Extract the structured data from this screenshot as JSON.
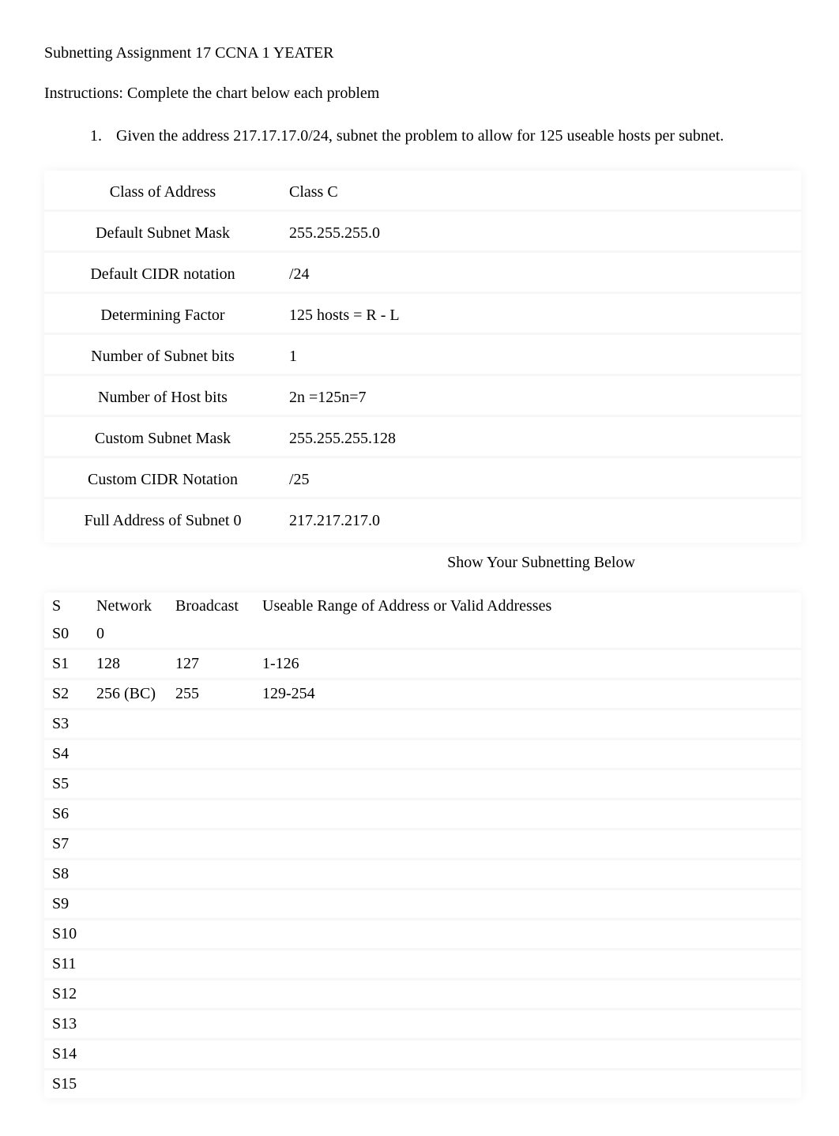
{
  "header": {
    "title": "Subnetting Assignment 17 CCNA 1 YEATER",
    "instructions": "Instructions: Complete the chart below each problem"
  },
  "problem": {
    "number": "1.",
    "text": "Given the address 217.17.17.0/24, subnet the problem to allow for 125 useable hosts per subnet."
  },
  "info_rows": [
    {
      "label": "Class of Address",
      "value": "Class C"
    },
    {
      "label": "Default Subnet Mask",
      "value": "255.255.255.0"
    },
    {
      "label": "Default CIDR notation",
      "value": "/24"
    },
    {
      "label": "Determining Factor",
      "value": "125 hosts = R - L"
    },
    {
      "label": "Number of Subnet bits",
      "value": "1"
    },
    {
      "label": "Number of Host bits",
      "value": "2n =125n=7"
    },
    {
      "label": "Custom Subnet Mask",
      "value": "255.255.255.128"
    },
    {
      "label": "Custom CIDR Notation",
      "value": "/25"
    },
    {
      "label": "Full Address of Subnet 0",
      "value": "217.217.217.0"
    }
  ],
  "show_label": "Show Your Subnetting Below",
  "sub_headers": {
    "s": "S",
    "network": "Network",
    "broadcast": "Broadcast",
    "range": "Useable Range of Address or Valid Addresses"
  },
  "sub_rows": [
    {
      "s": "S0",
      "network": "0",
      "broadcast": "",
      "range": ""
    },
    {
      "s": "S1",
      "network": "128",
      "broadcast": "127",
      "range": "1-126"
    },
    {
      "s": "S2",
      "network": "256 (BC)",
      "broadcast": "255",
      "range": "129-254"
    },
    {
      "s": "S3",
      "network": "",
      "broadcast": "",
      "range": ""
    },
    {
      "s": "S4",
      "network": "",
      "broadcast": "",
      "range": ""
    },
    {
      "s": "S5",
      "network": "",
      "broadcast": "",
      "range": ""
    },
    {
      "s": "S6",
      "network": "",
      "broadcast": "",
      "range": ""
    },
    {
      "s": "S7",
      "network": "",
      "broadcast": "",
      "range": ""
    },
    {
      "s": "S8",
      "network": "",
      "broadcast": "",
      "range": ""
    },
    {
      "s": "S9",
      "network": "",
      "broadcast": "",
      "range": ""
    },
    {
      "s": "S10",
      "network": "",
      "broadcast": "",
      "range": ""
    },
    {
      "s": "S11",
      "network": "",
      "broadcast": "",
      "range": ""
    },
    {
      "s": "S12",
      "network": "",
      "broadcast": "",
      "range": ""
    },
    {
      "s": "S13",
      "network": "",
      "broadcast": "",
      "range": ""
    },
    {
      "s": "S14",
      "network": "",
      "broadcast": "",
      "range": ""
    },
    {
      "s": "S15",
      "network": "",
      "broadcast": "",
      "range": ""
    }
  ]
}
